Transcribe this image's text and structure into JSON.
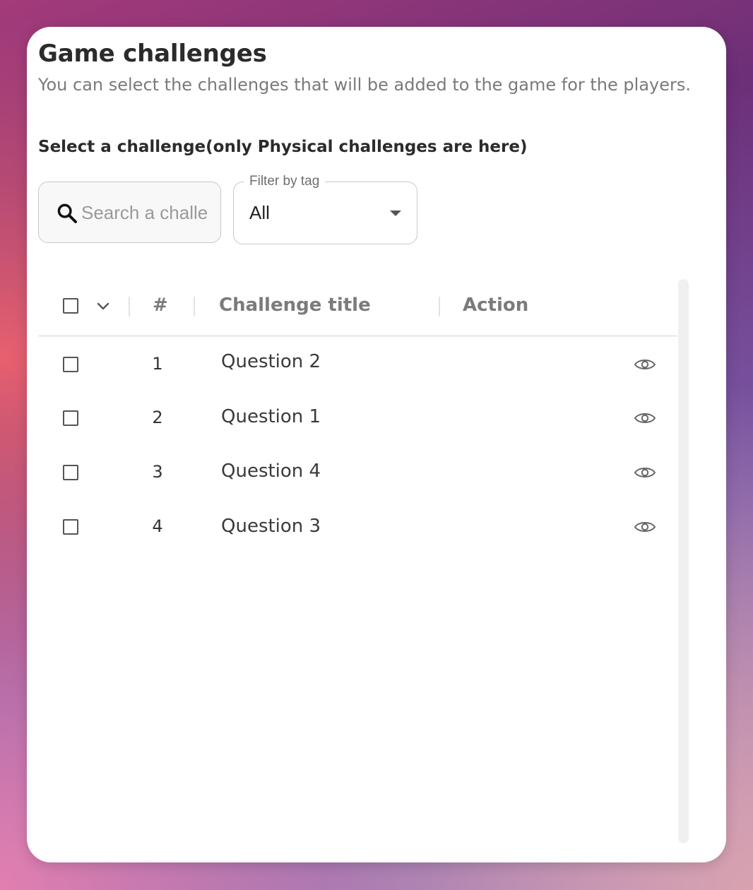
{
  "header": {
    "title": "Game challenges",
    "subtitle": "You can select the challenges that will be added to the game for the players."
  },
  "section_label": "Select a challenge(only Physical challenges are here)",
  "search": {
    "placeholder": "Search a challenge",
    "value": ""
  },
  "filter": {
    "label": "Filter by tag",
    "selected": "All"
  },
  "table": {
    "columns": [
      "#",
      "Challenge title",
      "Action"
    ],
    "rows": [
      {
        "num": "1",
        "title": "Question 2"
      },
      {
        "num": "2",
        "title": "Question 1"
      },
      {
        "num": "3",
        "title": "Question 4"
      },
      {
        "num": "4",
        "title": "Question 3"
      }
    ]
  },
  "icons": {
    "search": "search-icon",
    "dropdown": "caret-down-icon",
    "select_menu": "chevron-down-icon",
    "view": "eye-icon"
  }
}
